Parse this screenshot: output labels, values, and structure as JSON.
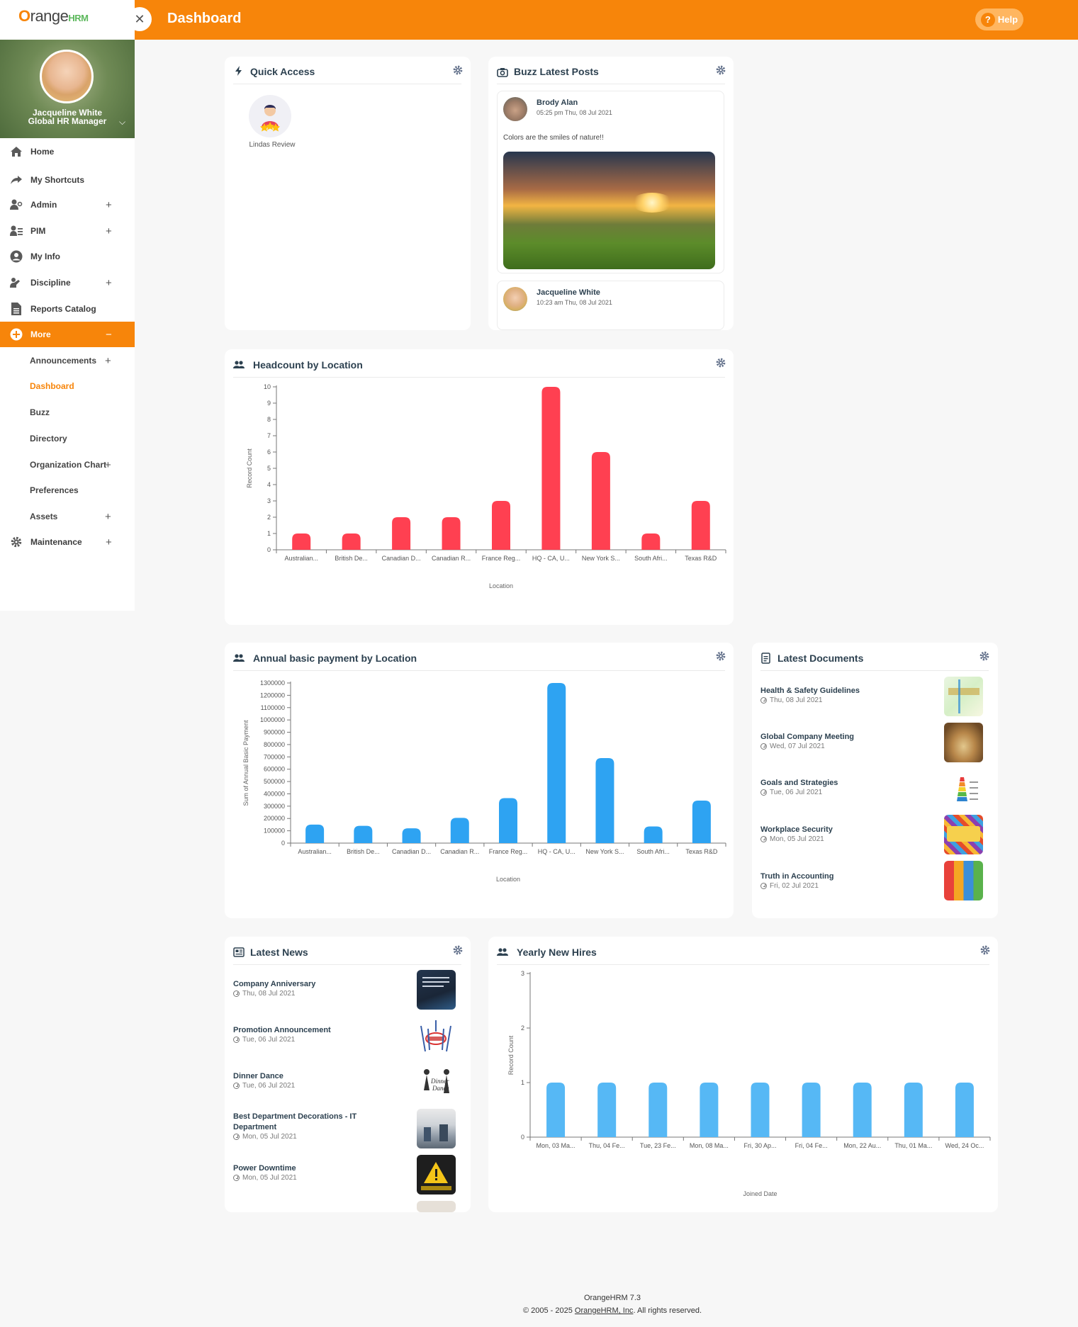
{
  "header": {
    "title": "Dashboard",
    "help_label": "Help"
  },
  "sidebar": {
    "profile": {
      "name": "Jacqueline White",
      "role": "Global HR Manager"
    },
    "menu": [
      {
        "label": "Home",
        "icon": "home-icon"
      },
      {
        "label": "My Shortcuts",
        "icon": "share-icon"
      },
      {
        "label": "Admin",
        "icon": "admin-icon",
        "expandable": true
      },
      {
        "label": "PIM",
        "icon": "pim-icon",
        "expandable": true
      },
      {
        "label": "My Info",
        "icon": "user-icon"
      },
      {
        "label": "Discipline",
        "icon": "discipline-icon",
        "expandable": true
      },
      {
        "label": "Reports Catalog",
        "icon": "report-icon"
      },
      {
        "label": "More",
        "icon": "plus-circle-icon",
        "active": true
      }
    ],
    "more_submenu": [
      {
        "label": "Announcements",
        "expandable": true
      },
      {
        "label": "Dashboard",
        "current": true
      },
      {
        "label": "Buzz"
      },
      {
        "label": "Directory"
      },
      {
        "label": "Organization Chart",
        "expandable": true
      },
      {
        "label": "Preferences"
      },
      {
        "label": "Assets",
        "expandable": true
      }
    ],
    "maintenance": {
      "label": "Maintenance",
      "icon": "gear-icon"
    }
  },
  "quick_access": {
    "title": "Quick Access",
    "items": [
      {
        "label": "Lindas Review"
      }
    ]
  },
  "buzz": {
    "title": "Buzz Latest Posts",
    "posts": [
      {
        "author": "Brody Alan",
        "time": "05:25 pm Thu, 08 Jul 2021",
        "text": "Colors are the smiles of nature!!"
      },
      {
        "author": "Jacqueline White",
        "time": "10:23 am Thu, 08 Jul 2021"
      }
    ]
  },
  "headcount": {
    "title": "Headcount by Location"
  },
  "annual_payment": {
    "title": "Annual basic payment by Location"
  },
  "latest_documents": {
    "title": "Latest Documents",
    "items": [
      {
        "title": "Health & Safety Guidelines",
        "date": "Thu, 08 Jul 2021"
      },
      {
        "title": "Global Company Meeting",
        "date": "Wed, 07 Jul 2021"
      },
      {
        "title": "Goals and Strategies",
        "date": "Tue, 06 Jul 2021"
      },
      {
        "title": "Workplace Security",
        "date": "Mon, 05 Jul 2021"
      },
      {
        "title": "Truth in Accounting",
        "date": "Fri, 02 Jul 2021"
      }
    ]
  },
  "latest_news": {
    "title": "Latest News",
    "items": [
      {
        "title": "Company Anniversary",
        "date": "Thu, 08 Jul 2021"
      },
      {
        "title": "Promotion Announcement",
        "date": "Tue, 06 Jul 2021"
      },
      {
        "title": "Dinner Dance",
        "date": "Tue, 06 Jul 2021"
      },
      {
        "title": "Best Department Decorations - IT Department",
        "date": "Mon, 05 Jul 2021"
      },
      {
        "title": "Power Downtime",
        "date": "Mon, 05 Jul 2021"
      }
    ]
  },
  "yearly_hires": {
    "title": "Yearly New Hires"
  },
  "footer": {
    "version": "OrangeHRM 7.3",
    "copyright_prefix": "© 2005 - 2025 ",
    "company_link": "OrangeHRM, Inc",
    "copyright_suffix": ". All rights reserved."
  },
  "chart_data": [
    {
      "type": "bar",
      "categories": [
        "Australian...",
        "British De...",
        "Canadian D...",
        "Canadian R...",
        "France Reg...",
        "HQ - CA, U...",
        "New York S...",
        "South Afri...",
        "Texas R&D"
      ],
      "values": [
        1,
        1,
        2,
        2,
        3,
        10,
        6,
        1,
        3
      ],
      "xlabel": "Location",
      "ylabel": "Record Count",
      "ylim": [
        0,
        10
      ],
      "yticks": [
        0,
        1,
        2,
        3,
        4,
        5,
        6,
        7,
        8,
        9,
        10
      ],
      "color": "#ff4051"
    },
    {
      "type": "bar",
      "categories": [
        "Australian...",
        "British De...",
        "Canadian D...",
        "Canadian R...",
        "France Reg...",
        "HQ - CA, U...",
        "New York S...",
        "South Afri...",
        "Texas R&D"
      ],
      "values": [
        150000,
        140000,
        120000,
        205000,
        365000,
        1300000,
        690000,
        135000,
        345000
      ],
      "xlabel": "Location",
      "ylabel": "Sum of Annual Basic Payment",
      "ylim": [
        0,
        1300000
      ],
      "yticks": [
        0,
        100000,
        200000,
        300000,
        400000,
        500000,
        600000,
        700000,
        800000,
        900000,
        1000000,
        1100000,
        1200000,
        1300000
      ],
      "color": "#2ea3f2"
    },
    {
      "type": "bar",
      "categories": [
        "Mon, 03 Ma...",
        "Thu, 04 Fe...",
        "Tue, 23 Fe...",
        "Mon, 08 Ma...",
        "Fri, 30 Ap...",
        "Fri, 04 Fe...",
        "Mon, 22 Au...",
        "Thu, 01 Ma...",
        "Wed, 24 Oc..."
      ],
      "values": [
        1,
        1,
        1,
        1,
        1,
        1,
        1,
        1,
        1
      ],
      "xlabel": "Joined Date",
      "ylabel": "Record Count",
      "ylim": [
        0,
        3
      ],
      "yticks": [
        0,
        1,
        2,
        3
      ],
      "color": "#56b8f5"
    }
  ]
}
